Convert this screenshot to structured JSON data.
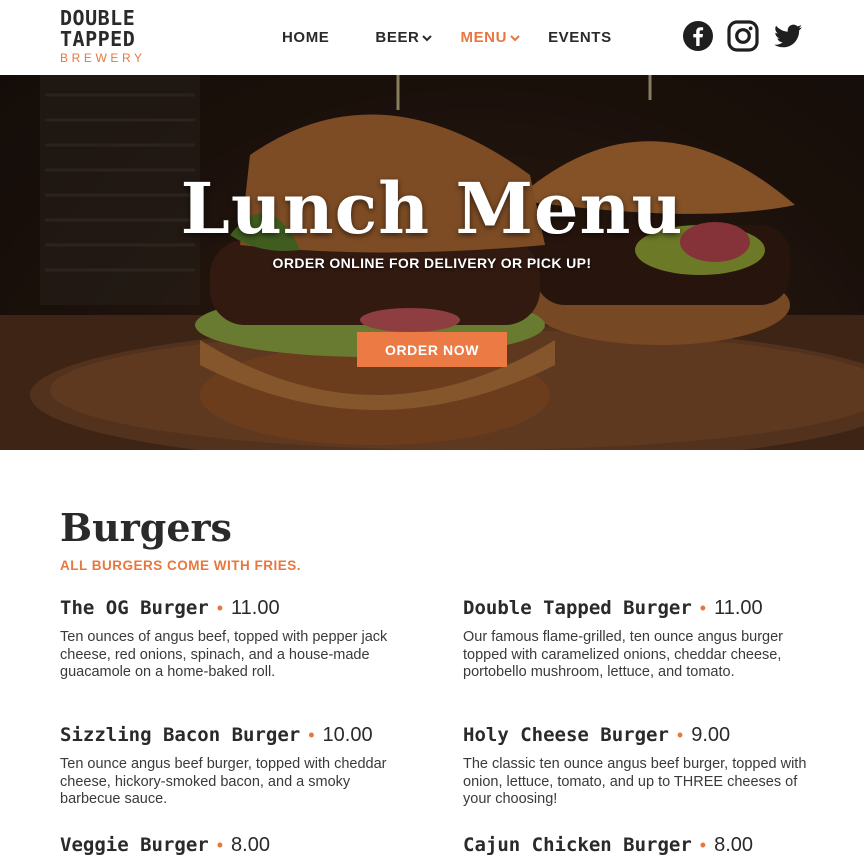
{
  "brand": {
    "line1": "DOUBLE",
    "line2": "TAPPED",
    "line3": "BREWERY",
    "accent_color": "#e8773e"
  },
  "nav": {
    "home": "HOME",
    "beer": "BEER",
    "menu": "MENU",
    "events": "EVENTS"
  },
  "social": {
    "icons": [
      "facebook-icon",
      "instagram-icon",
      "twitter-icon"
    ]
  },
  "hero": {
    "title": "Lunch Menu",
    "subtitle": "ORDER ONLINE FOR DELIVERY OR PICK UP!",
    "button": "ORDER NOW",
    "button_color": "#ec7a45"
  },
  "section": {
    "title": "Burgers",
    "note": "ALL BURGERS COME WITH FRIES."
  },
  "items": [
    {
      "name": "The OG Burger",
      "price": "11.00",
      "desc": "Ten ounces of angus beef, topped with pepper jack cheese, red onions, spinach, and a house-made guacamole on a home-baked roll."
    },
    {
      "name": "Double Tapped Burger",
      "price": "11.00",
      "desc": "Our famous flame-grilled, ten ounce angus burger topped with caramelized onions, cheddar cheese, portobello mushroom, lettuce, and tomato."
    },
    {
      "name": "Sizzling Bacon Burger",
      "price": "10.00",
      "desc": "Ten ounce angus beef burger, topped with cheddar cheese, hickory-smoked bacon, and a smoky barbecue sauce."
    },
    {
      "name": "Holy Cheese Burger",
      "price": "9.00",
      "desc": "The classic ten ounce angus beef burger, topped with onion, lettuce, tomato, and up to THREE cheeses of your choosing!"
    },
    {
      "name": "Veggie Burger",
      "price": "8.00",
      "desc": ""
    },
    {
      "name": "Cajun Chicken Burger",
      "price": "8.00",
      "desc": ""
    }
  ]
}
